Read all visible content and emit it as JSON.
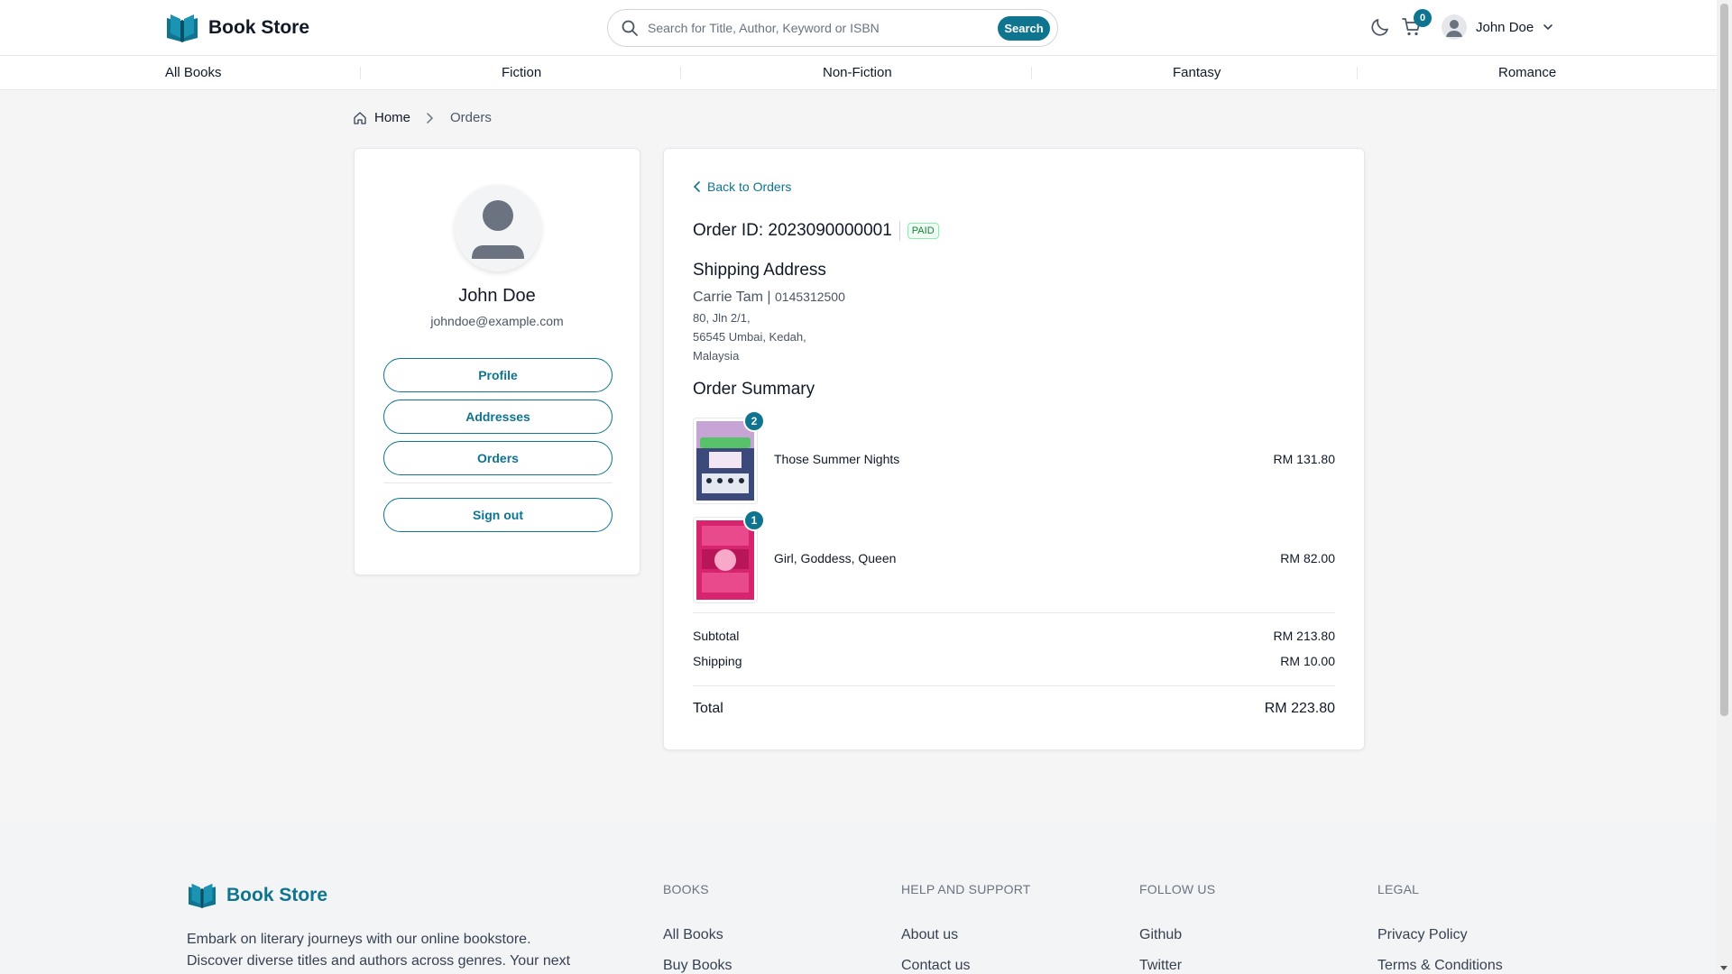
{
  "header": {
    "brand": "Book Store",
    "search_placeholder": "Search for Title, Author, Keyword or ISBN",
    "search_button": "Search",
    "cart_count": "0",
    "user_name": "John Doe"
  },
  "categories": [
    "All Books",
    "Fiction",
    "Non-Fiction",
    "Fantasy",
    "Romance"
  ],
  "breadcrumb": {
    "home": "Home",
    "current": "Orders"
  },
  "sidebar": {
    "name": "John Doe",
    "email": "johndoe@example.com",
    "buttons": {
      "profile": "Profile",
      "addresses": "Addresses",
      "orders": "Orders",
      "signout": "Sign out"
    }
  },
  "order": {
    "back_label": "Back to Orders",
    "id_label": "Order ID: 2023090000001",
    "status": "PAID",
    "shipping_heading": "Shipping Address",
    "recipient": "Carrie Tam",
    "phone_sep": "|",
    "phone": "0145312500",
    "address_lines": [
      "80, Jln 2/1,",
      "56545 Umbai, Kedah,",
      "Malaysia"
    ],
    "summary_heading": "Order Summary",
    "items": [
      {
        "title": "Those Summer Nights",
        "qty": "2",
        "price": "RM 131.80",
        "cover_color": "#3b4a7a"
      },
      {
        "title": "Girl, Goddess, Queen",
        "qty": "1",
        "price": "RM 82.00",
        "cover_color": "#d6246e"
      }
    ],
    "subtotal_label": "Subtotal",
    "subtotal": "RM 213.80",
    "shipping_label": "Shipping",
    "shipping": "RM 10.00",
    "total_label": "Total",
    "total": "RM 223.80"
  },
  "footer": {
    "brand": "Book Store",
    "tagline": "Embark on literary journeys with our online bookstore. Discover diverse titles and authors across genres. Your next",
    "columns": [
      {
        "heading": "BOOKS",
        "links": [
          "All Books",
          "Buy Books"
        ]
      },
      {
        "heading": "HELP AND SUPPORT",
        "links": [
          "About us",
          "Contact us"
        ]
      },
      {
        "heading": "FOLLOW US",
        "links": [
          "Github",
          "Twitter"
        ]
      },
      {
        "heading": "LEGAL",
        "links": [
          "Privacy Policy",
          "Terms & Conditions"
        ]
      }
    ]
  },
  "colors": {
    "accent": "#0e7490",
    "paid": "#15803d",
    "page_bg": "#f5f5f6"
  }
}
